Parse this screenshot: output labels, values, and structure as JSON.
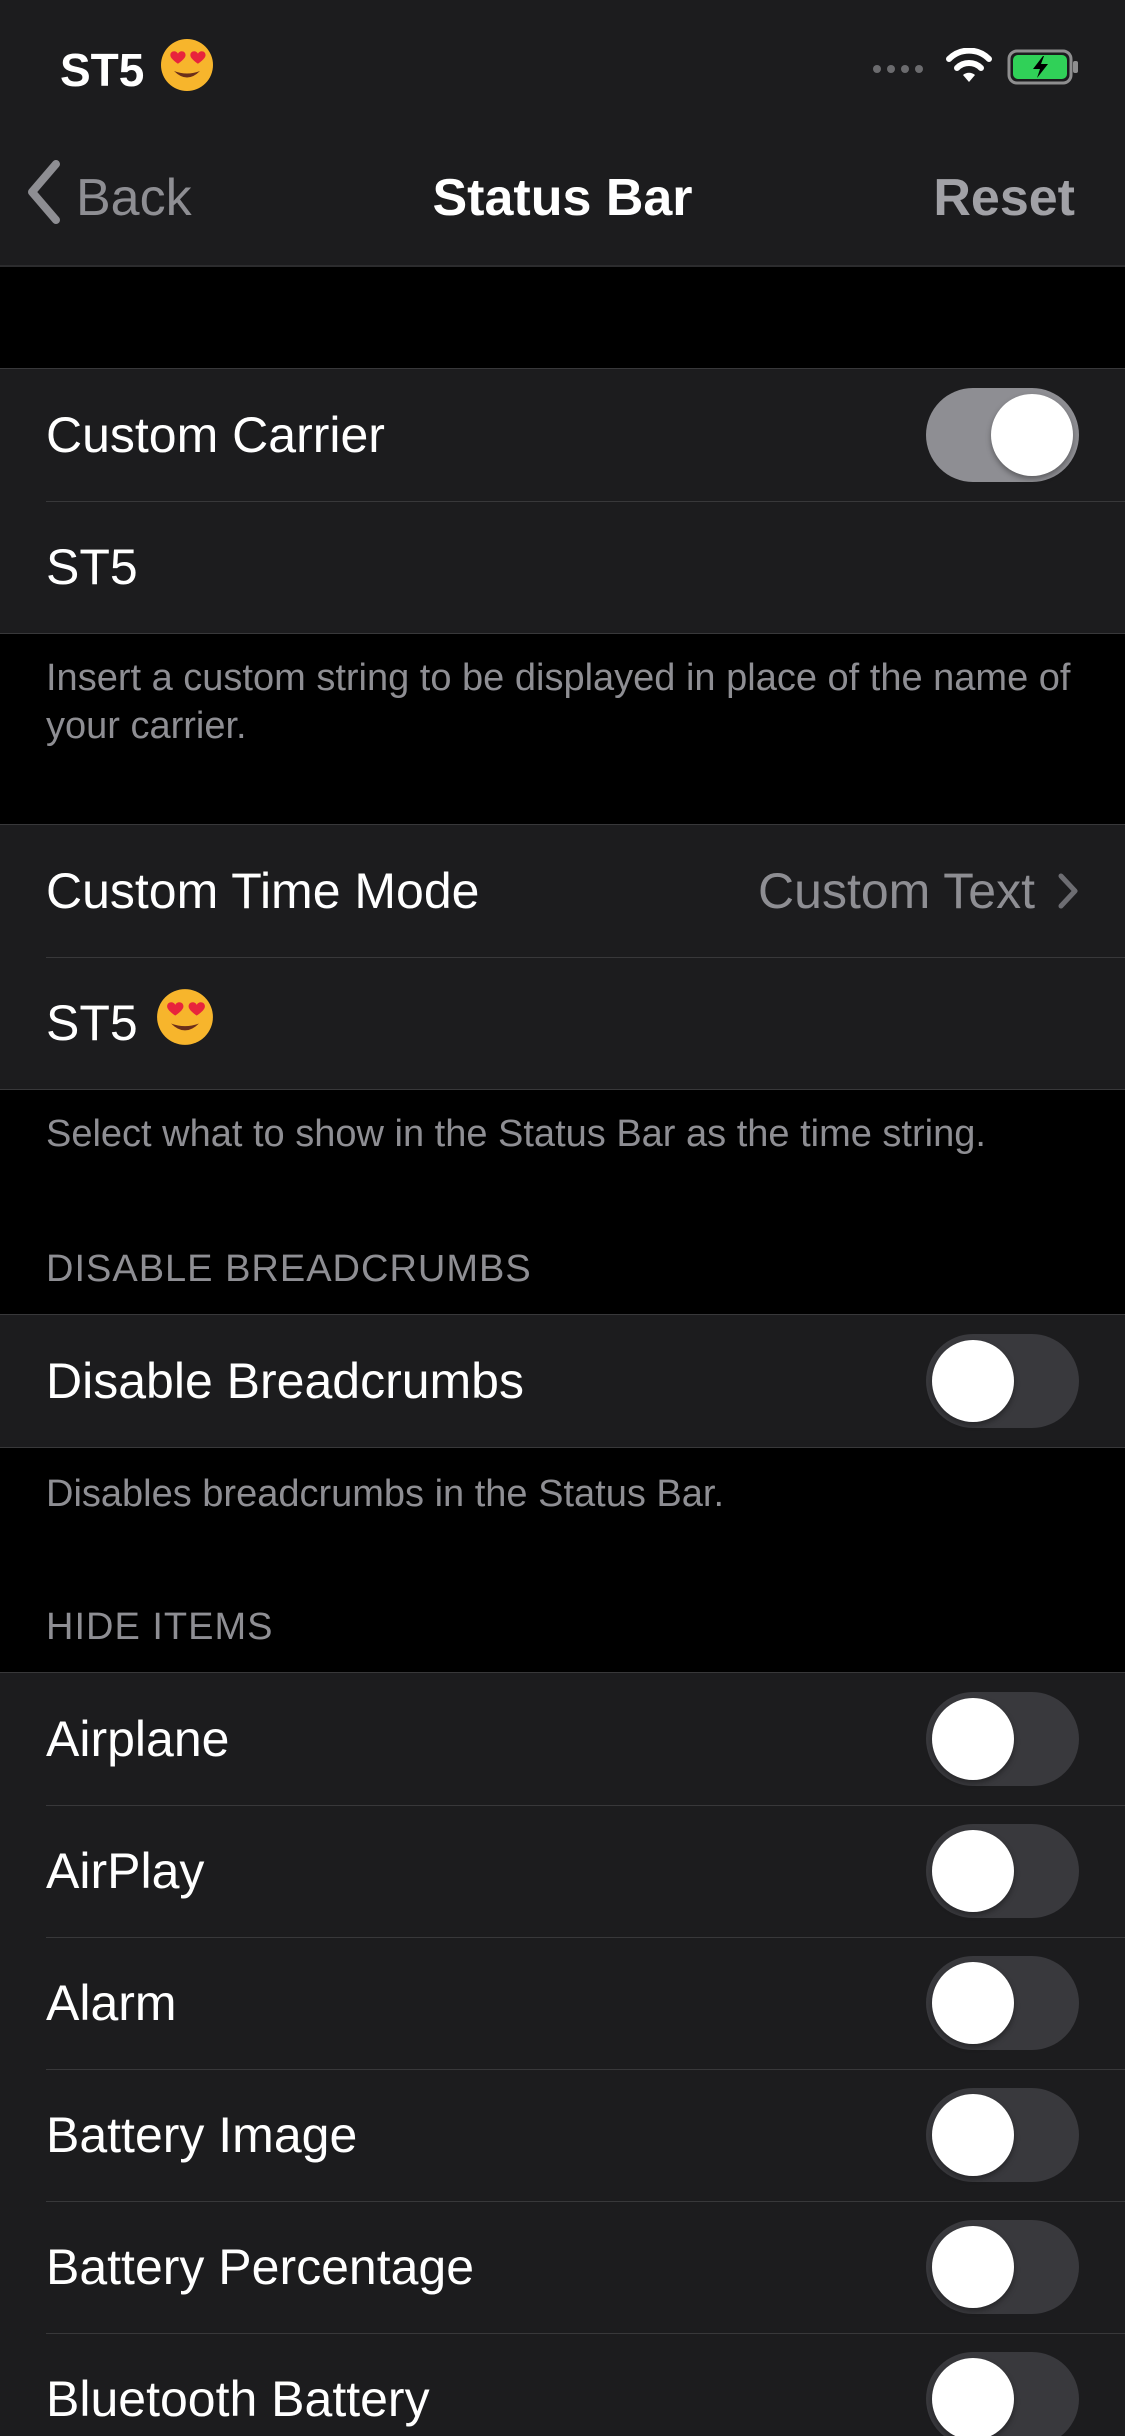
{
  "status_bar": {
    "carrier": "ST5",
    "carrier_emoji_icon": "heart-eyes-emoji-icon",
    "signal_icon": "signal-dots-icon",
    "wifi_icon": "wifi-icon",
    "battery_icon": "battery-charging-icon",
    "battery_color": "#30d158"
  },
  "nav": {
    "back_label": "Back",
    "title": "Status Bar",
    "reset_label": "Reset"
  },
  "custom_carrier": {
    "label": "Custom Carrier",
    "enabled": true,
    "value": "ST5",
    "footer": "Insert a custom string to be displayed in place of the name of your carrier."
  },
  "custom_time": {
    "label": "Custom Time Mode",
    "mode_value": "Custom Text",
    "text_value": "ST5",
    "text_emoji_icon": "heart-eyes-emoji-icon",
    "footer": "Select what to show in the Status Bar as the time string."
  },
  "breadcrumbs": {
    "header": "DISABLE BREADCRUMBS",
    "label": "Disable Breadcrumbs",
    "enabled": false,
    "footer": "Disables breadcrumbs in the Status Bar."
  },
  "hide_items": {
    "header": "HIDE ITEMS",
    "items": [
      {
        "label": "Airplane",
        "enabled": false
      },
      {
        "label": "AirPlay",
        "enabled": false
      },
      {
        "label": "Alarm",
        "enabled": false
      },
      {
        "label": "Battery Image",
        "enabled": false
      },
      {
        "label": "Battery Percentage",
        "enabled": false
      },
      {
        "label": "Bluetooth Battery",
        "enabled": false
      }
    ]
  },
  "colors": {
    "background": "#000000",
    "cell_background": "#1c1c1e",
    "secondary_text": "#8e8e93",
    "toggle_off": "#39393d",
    "toggle_on": "#8e8e93"
  }
}
